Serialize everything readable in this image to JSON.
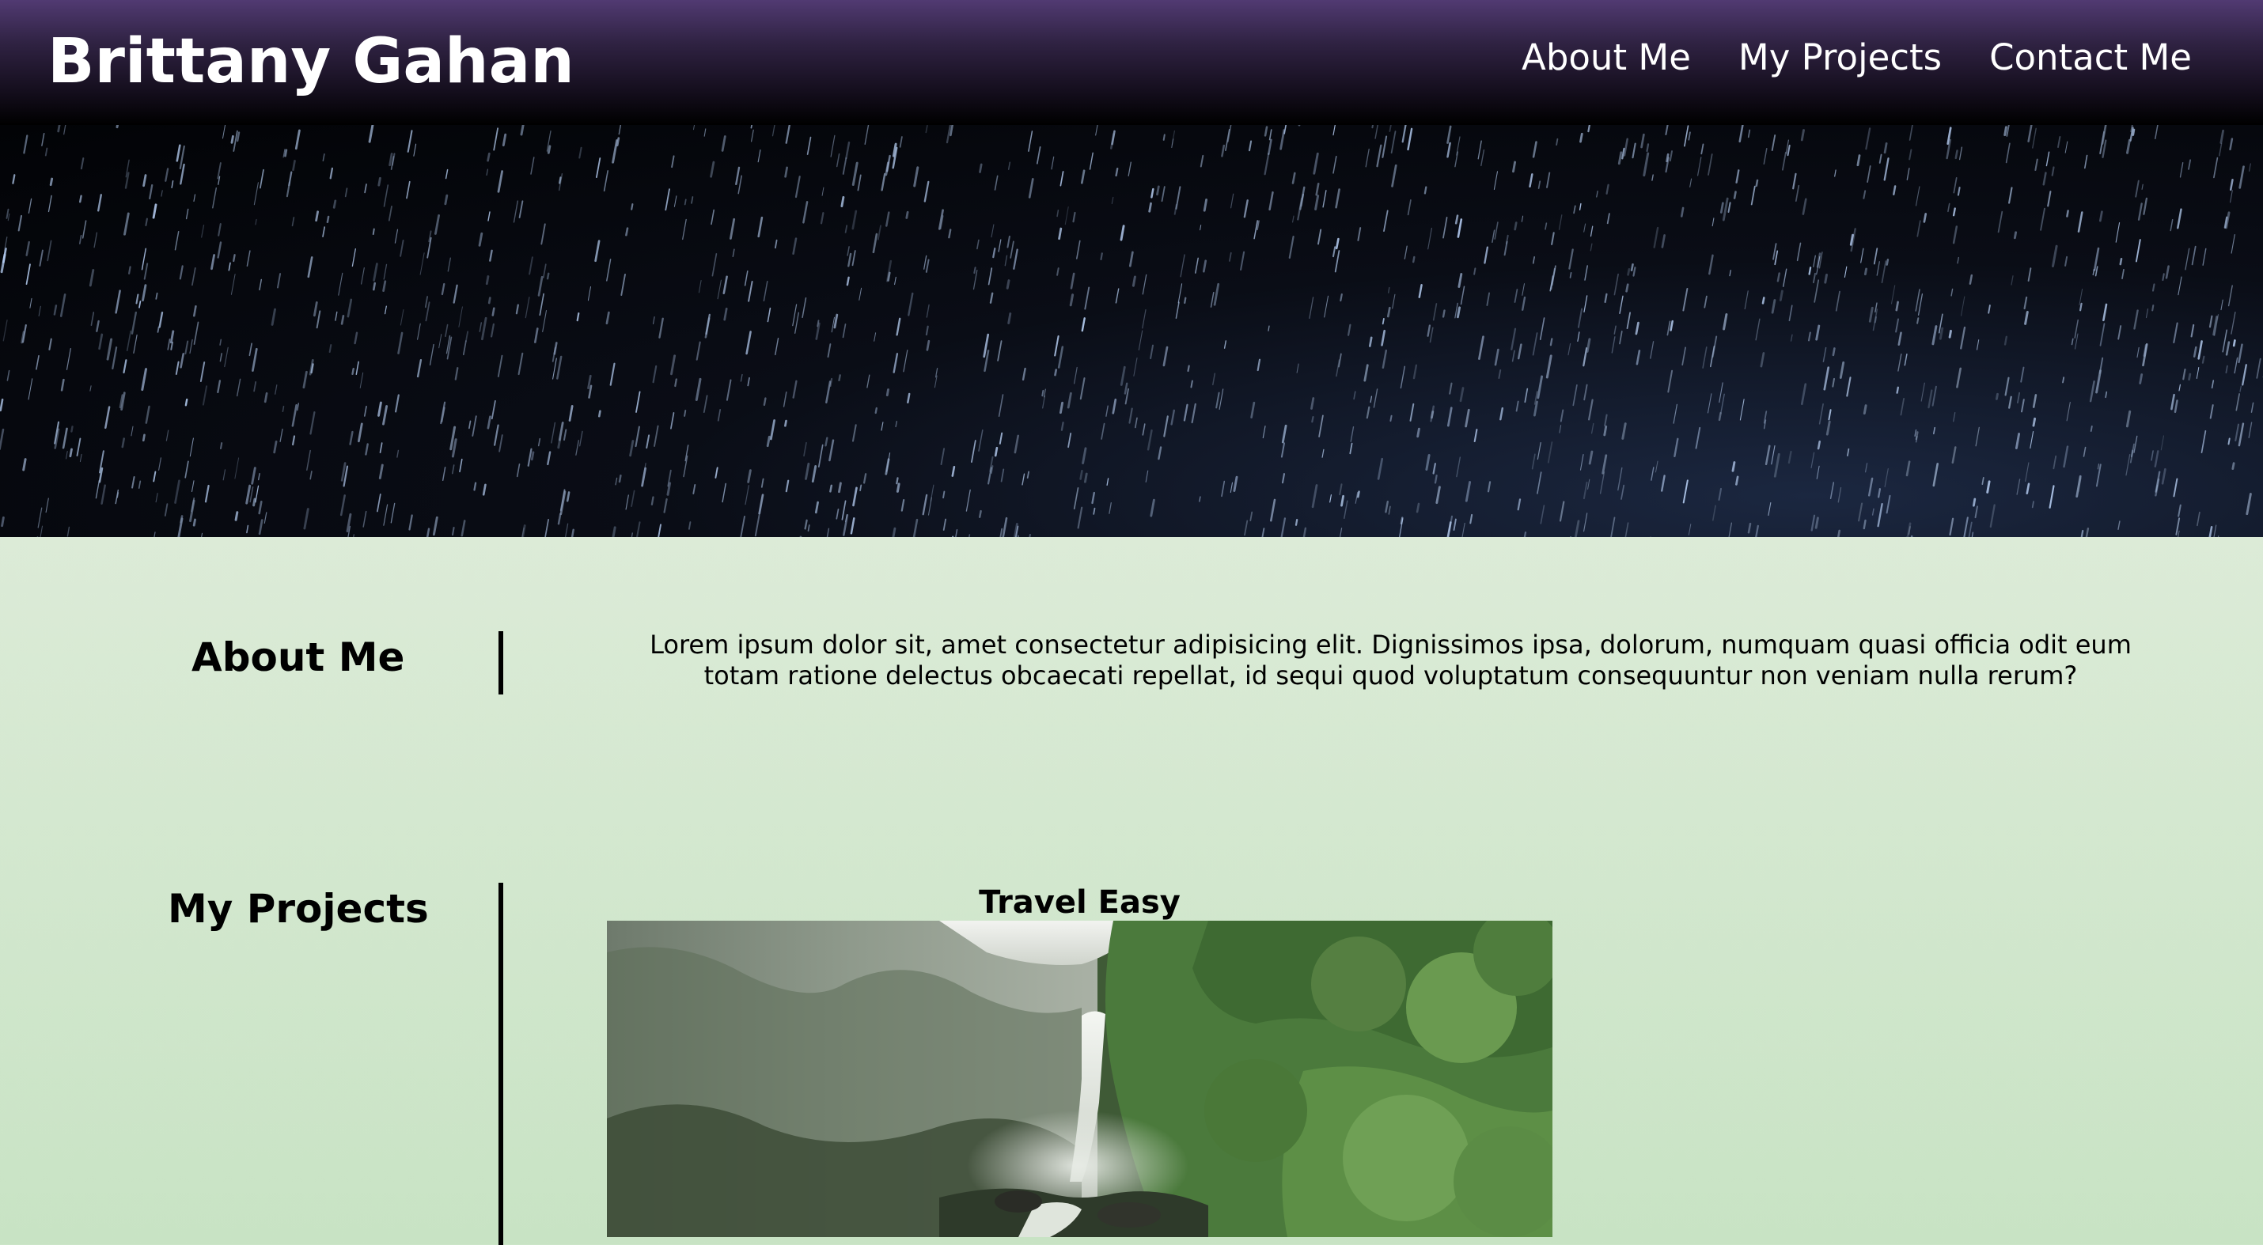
{
  "header": {
    "brand": "Brittany Gahan",
    "nav": [
      {
        "label": "About Me"
      },
      {
        "label": "My Projects"
      },
      {
        "label": "Contact Me"
      }
    ]
  },
  "hero": {
    "image": "night-sky-rain-streaks"
  },
  "about": {
    "title": "About Me",
    "text": "Lorem ipsum dolor sit, amet consectetur adipisicing elit. Dignissimos ipsa, dolorum, numquam quasi officia odit eum totam ratione delectus obcaecati repellat, id sequi quod voluptatum consequuntur non veniam nulla rerum?"
  },
  "projects": {
    "title": "My Projects",
    "items": [
      {
        "title": "Travel Easy",
        "image": "forest-waterfall-photo"
      }
    ]
  },
  "colors": {
    "header_top": "#513a72",
    "header_bottom": "#000000",
    "page_top": "#ebf1e6",
    "page_bottom": "#c8e3c4",
    "text": "#000000"
  }
}
